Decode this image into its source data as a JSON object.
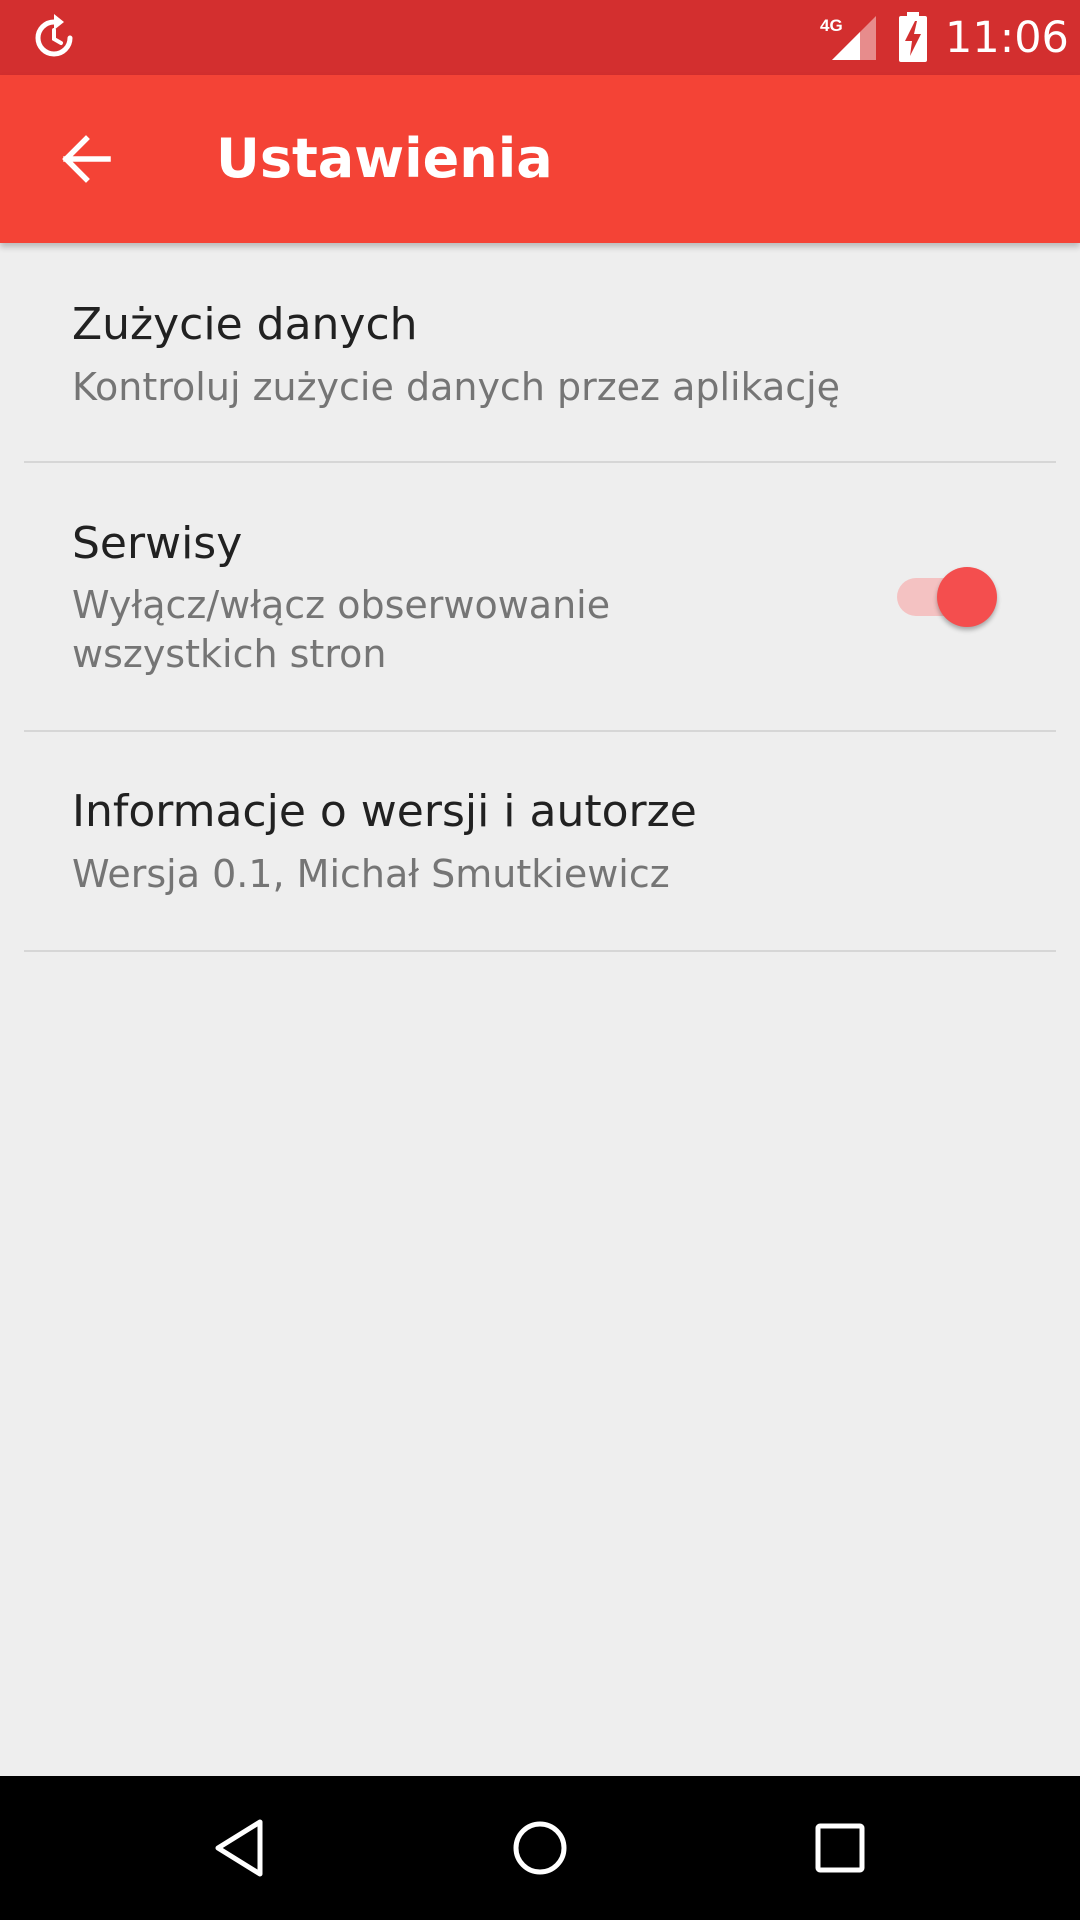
{
  "status_bar": {
    "time": "11:06",
    "network_label": "4G",
    "icons": [
      "sync-icon",
      "signal-icon",
      "battery-charging-icon"
    ]
  },
  "app_bar": {
    "title": "Ustawienia",
    "back_icon": "arrow-back-icon"
  },
  "settings": [
    {
      "title": "Zużycie danych",
      "summary": "Kontroluj zużycie danych przez aplikację"
    },
    {
      "title": "Serwisy",
      "summary_lines": [
        "Wyłącz/włącz obserwowanie",
        "wszystkich stron"
      ],
      "toggle_on": true
    },
    {
      "title": "Informacje o wersji i autorze",
      "summary": "Wersja 0.1, Michał Smutkiewicz"
    }
  ],
  "navigation": {
    "icons": [
      "nav-back-icon",
      "nav-home-icon",
      "nav-recents-icon"
    ]
  },
  "colors": {
    "status_bar": "#d32f2f",
    "app_bar": "#f44336",
    "accent": "#f44e4e",
    "background": "#eeeeee"
  }
}
